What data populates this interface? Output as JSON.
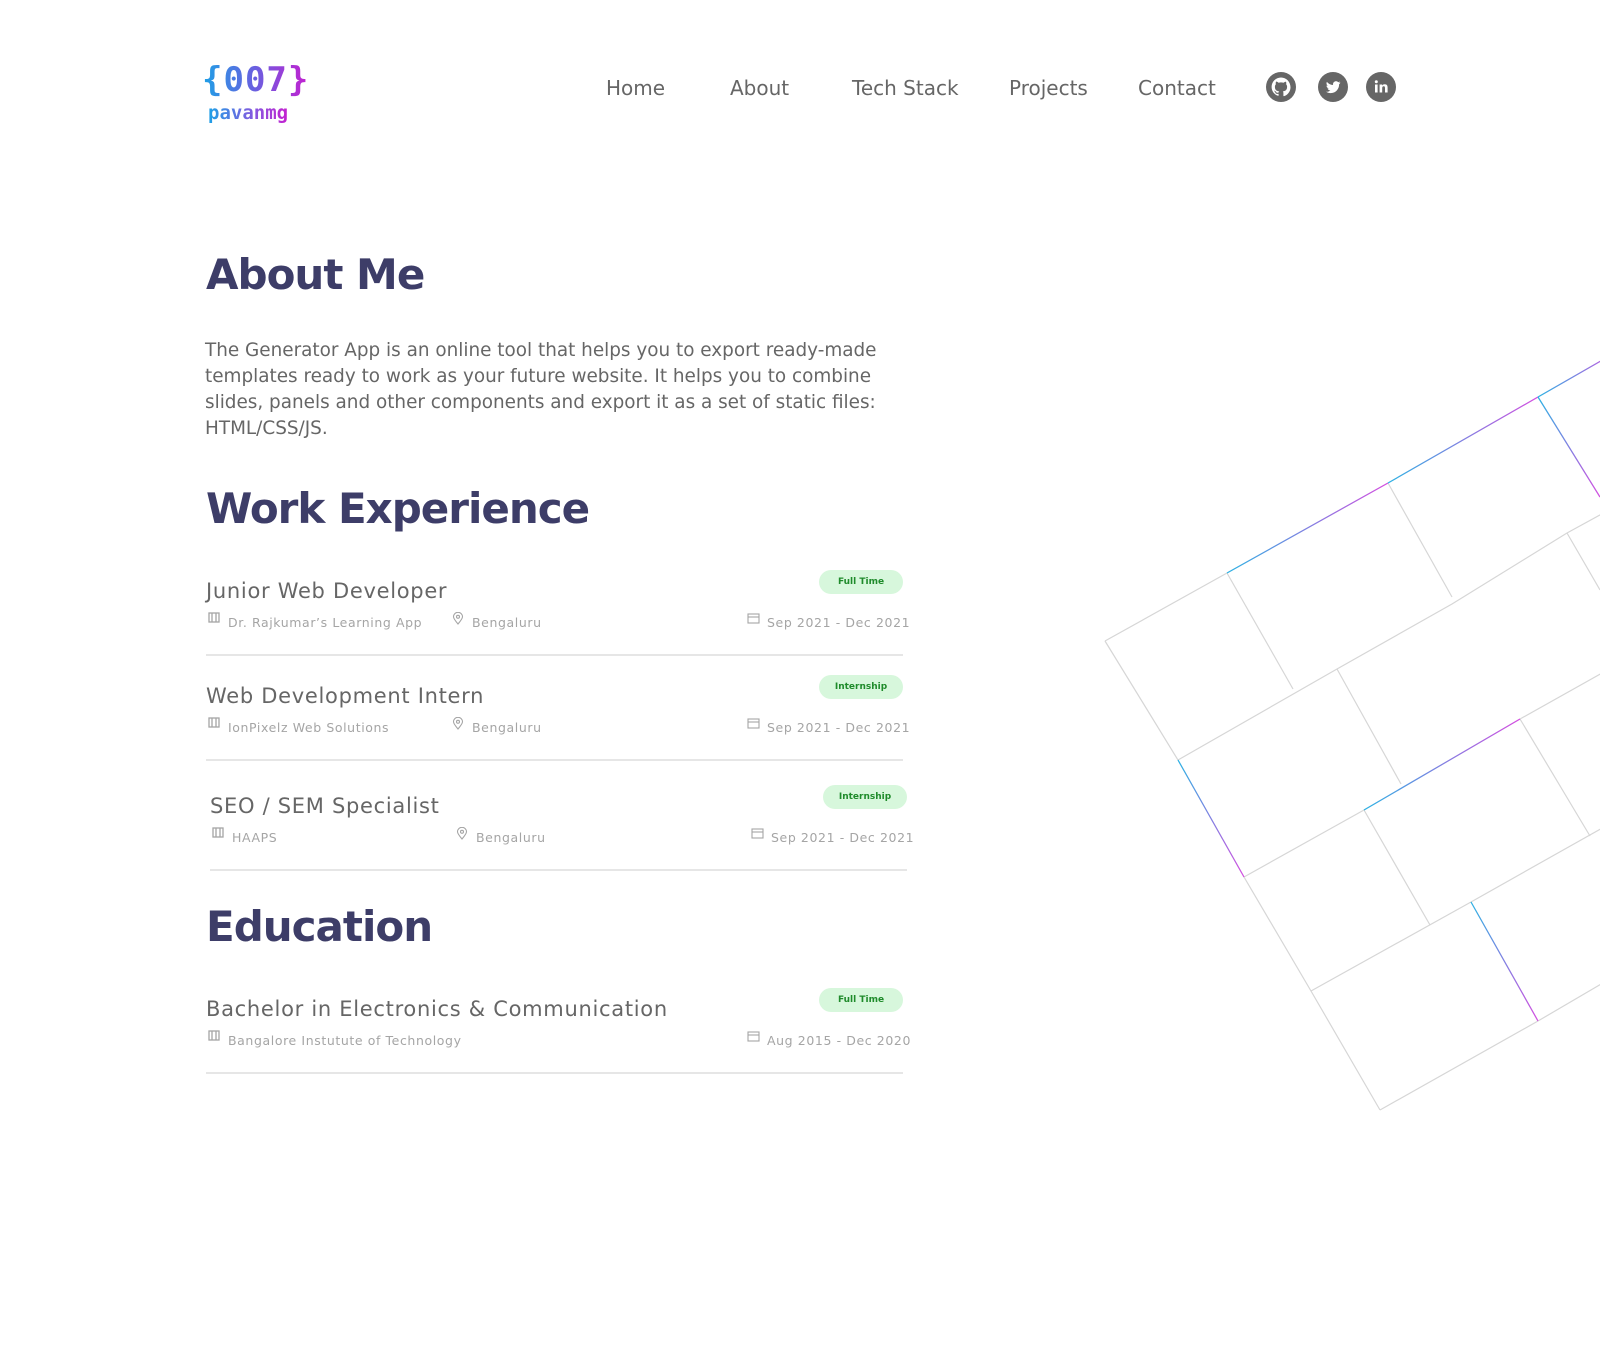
{
  "logo": {
    "code": "{007}",
    "name": "pavanmg"
  },
  "nav": {
    "links": [
      "Home",
      "About",
      "Tech Stack",
      "Projects",
      "Contact"
    ],
    "social": [
      "github-icon",
      "twitter-icon",
      "linkedin-icon"
    ]
  },
  "about": {
    "title": "About Me",
    "text": "The Generator App is an online tool that helps you to export ready-made templates ready to work as your future website. It helps you to combine slides, panels and other components and export it as a set of static files: HTML/CSS/JS."
  },
  "work": {
    "title": "Work Experience",
    "items": [
      {
        "title": "Junior Web Developer",
        "badge": "Full Time",
        "company": "Dr. Rajkumar’s Learning App",
        "location": "Bengaluru",
        "dates": "Sep 2021 - Dec 2021"
      },
      {
        "title": "Web Development Intern",
        "badge": "Internship",
        "company": "IonPixelz Web Solutions",
        "location": "Bengaluru",
        "dates": "Sep 2021 - Dec 2021"
      },
      {
        "title": "SEO / SEM Specialist",
        "badge": "Internship",
        "company": "HAAPS",
        "location": "Bengaluru",
        "dates": "Sep 2021 - Dec 2021"
      }
    ]
  },
  "education": {
    "title": "Education",
    "items": [
      {
        "title": "Bachelor in Electronics & Communication",
        "badge": "Full Time",
        "company": "Bangalore Instutute of Technology",
        "dates": "Aug 2015 - Dec 2020"
      }
    ]
  },
  "colors": {
    "heading": "#3d3d68",
    "text": "#666666",
    "meta": "#a5a5a5",
    "badge_bg": "#d7f7dc",
    "badge_text": "#1f8b2b",
    "gradient_start": "#1da1e6",
    "gradient_end": "#c41fd0"
  }
}
